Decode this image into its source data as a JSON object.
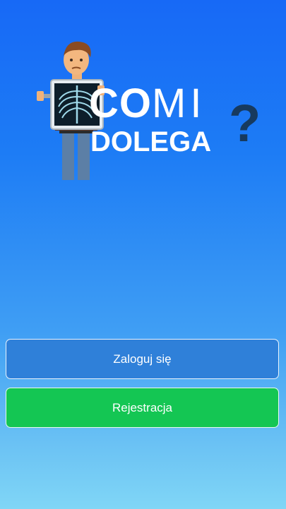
{
  "logo": {
    "line1_bold": "CO",
    "line1_light": "MI",
    "line2": "DOLEGA",
    "mark": "?"
  },
  "buttons": {
    "login_label": "Zaloguj się",
    "register_label": "Rejestracja"
  },
  "colors": {
    "background_top": "#1769f6",
    "background_bottom": "#80d6f6",
    "login_button": "#2f80d9",
    "register_button": "#14c653",
    "question_mark": "#173a5e"
  },
  "icons": {
    "mascot": "doctor-with-xray-icon"
  }
}
